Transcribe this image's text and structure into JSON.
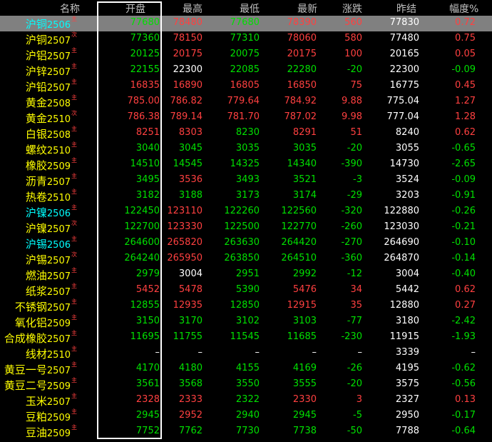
{
  "colors": {
    "up": "#ff4040",
    "down": "#00e000",
    "flat": "#ffffff",
    "name": "#ffff00",
    "name_alt": "#00ffff"
  },
  "headers": [
    "名称",
    "开盘",
    "最高",
    "最低",
    "最新",
    "涨跌",
    "昨结",
    "幅度%"
  ],
  "rows": [
    {
      "name": "沪铜",
      "code": "2506",
      "tag": "主",
      "nc": "cyan",
      "sel": true,
      "cells": [
        [
          "77680",
          "d"
        ],
        [
          "78480",
          "u"
        ],
        [
          "77680",
          "d"
        ],
        [
          "78390",
          "u"
        ],
        [
          "560",
          "u"
        ],
        [
          "77830",
          "w"
        ],
        [
          "0.72",
          "u"
        ]
      ]
    },
    {
      "name": "沪铜",
      "code": "2507",
      "tag": "次",
      "nc": "yellow",
      "cells": [
        [
          "77360",
          "d"
        ],
        [
          "78150",
          "u"
        ],
        [
          "77310",
          "d"
        ],
        [
          "78060",
          "u"
        ],
        [
          "580",
          "u"
        ],
        [
          "77480",
          "w"
        ],
        [
          "0.75",
          "u"
        ]
      ]
    },
    {
      "name": "沪铝",
      "code": "2507",
      "tag": "主",
      "nc": "yellow",
      "cells": [
        [
          "20125",
          "d"
        ],
        [
          "20175",
          "u"
        ],
        [
          "20075",
          "d"
        ],
        [
          "20175",
          "u"
        ],
        [
          "100",
          "u"
        ],
        [
          "20165",
          "w"
        ],
        [
          "0.05",
          "u"
        ]
      ]
    },
    {
      "name": "沪锌",
      "code": "2507",
      "tag": "主",
      "nc": "yellow",
      "cells": [
        [
          "22155",
          "d"
        ],
        [
          "22300",
          "w"
        ],
        [
          "22085",
          "d"
        ],
        [
          "22280",
          "d"
        ],
        [
          "-20",
          "d"
        ],
        [
          "22300",
          "w"
        ],
        [
          "-0.09",
          "d"
        ]
      ]
    },
    {
      "name": "沪铅",
      "code": "2507",
      "tag": "主",
      "nc": "yellow",
      "cells": [
        [
          "16835",
          "u"
        ],
        [
          "16890",
          "u"
        ],
        [
          "16805",
          "u"
        ],
        [
          "16850",
          "u"
        ],
        [
          "75",
          "u"
        ],
        [
          "16775",
          "w"
        ],
        [
          "0.45",
          "u"
        ]
      ]
    },
    {
      "name": "黄金",
      "code": "2508",
      "tag": "主",
      "nc": "yellow",
      "cells": [
        [
          "785.00",
          "u"
        ],
        [
          "786.82",
          "u"
        ],
        [
          "779.64",
          "u"
        ],
        [
          "784.92",
          "u"
        ],
        [
          "9.88",
          "u"
        ],
        [
          "775.04",
          "w"
        ],
        [
          "1.27",
          "u"
        ]
      ]
    },
    {
      "name": "黄金",
      "code": "2510",
      "tag": "次",
      "nc": "yellow",
      "cells": [
        [
          "786.38",
          "u"
        ],
        [
          "789.14",
          "u"
        ],
        [
          "781.70",
          "u"
        ],
        [
          "787.02",
          "u"
        ],
        [
          "9.98",
          "u"
        ],
        [
          "777.04",
          "w"
        ],
        [
          "1.28",
          "u"
        ]
      ]
    },
    {
      "name": "白银",
      "code": "2508",
      "tag": "主",
      "nc": "yellow",
      "cells": [
        [
          "8251",
          "u"
        ],
        [
          "8303",
          "u"
        ],
        [
          "8230",
          "d"
        ],
        [
          "8291",
          "u"
        ],
        [
          "51",
          "u"
        ],
        [
          "8240",
          "w"
        ],
        [
          "0.62",
          "u"
        ]
      ]
    },
    {
      "name": "螺纹",
      "code": "2510",
      "tag": "主",
      "nc": "yellow",
      "cells": [
        [
          "3040",
          "d"
        ],
        [
          "3045",
          "d"
        ],
        [
          "3035",
          "d"
        ],
        [
          "3035",
          "d"
        ],
        [
          "-20",
          "d"
        ],
        [
          "3055",
          "w"
        ],
        [
          "-0.65",
          "d"
        ]
      ]
    },
    {
      "name": "橡胶",
      "code": "2509",
      "tag": "主",
      "nc": "yellow",
      "cells": [
        [
          "14510",
          "d"
        ],
        [
          "14545",
          "d"
        ],
        [
          "14325",
          "d"
        ],
        [
          "14340",
          "d"
        ],
        [
          "-390",
          "d"
        ],
        [
          "14730",
          "w"
        ],
        [
          "-2.65",
          "d"
        ]
      ]
    },
    {
      "name": "沥青",
      "code": "2507",
      "tag": "主",
      "nc": "yellow",
      "cells": [
        [
          "3495",
          "d"
        ],
        [
          "3536",
          "u"
        ],
        [
          "3493",
          "d"
        ],
        [
          "3521",
          "d"
        ],
        [
          "-3",
          "d"
        ],
        [
          "3524",
          "w"
        ],
        [
          "-0.09",
          "d"
        ]
      ]
    },
    {
      "name": "热卷",
      "code": "2510",
      "tag": "主",
      "nc": "yellow",
      "cells": [
        [
          "3182",
          "d"
        ],
        [
          "3188",
          "d"
        ],
        [
          "3173",
          "d"
        ],
        [
          "3174",
          "d"
        ],
        [
          "-29",
          "d"
        ],
        [
          "3203",
          "w"
        ],
        [
          "-0.91",
          "d"
        ]
      ]
    },
    {
      "name": "沪镍",
      "code": "2506",
      "tag": "主",
      "nc": "cyan",
      "cells": [
        [
          "122450",
          "d"
        ],
        [
          "123110",
          "u"
        ],
        [
          "122260",
          "d"
        ],
        [
          "122560",
          "d"
        ],
        [
          "-320",
          "d"
        ],
        [
          "122880",
          "w"
        ],
        [
          "-0.26",
          "d"
        ]
      ]
    },
    {
      "name": "沪镍",
      "code": "2507",
      "tag": "次",
      "nc": "yellow",
      "cells": [
        [
          "122700",
          "d"
        ],
        [
          "123330",
          "u"
        ],
        [
          "122500",
          "d"
        ],
        [
          "122770",
          "d"
        ],
        [
          "-260",
          "d"
        ],
        [
          "123030",
          "w"
        ],
        [
          "-0.21",
          "d"
        ]
      ]
    },
    {
      "name": "沪锡",
      "code": "2506",
      "tag": "主",
      "nc": "cyan",
      "cells": [
        [
          "264600",
          "d"
        ],
        [
          "265820",
          "u"
        ],
        [
          "263630",
          "d"
        ],
        [
          "264420",
          "d"
        ],
        [
          "-270",
          "d"
        ],
        [
          "264690",
          "w"
        ],
        [
          "-0.10",
          "d"
        ]
      ]
    },
    {
      "name": "沪锡",
      "code": "2507",
      "tag": "次",
      "nc": "yellow",
      "cells": [
        [
          "264240",
          "d"
        ],
        [
          "265950",
          "u"
        ],
        [
          "263850",
          "d"
        ],
        [
          "264510",
          "d"
        ],
        [
          "-360",
          "d"
        ],
        [
          "264870",
          "w"
        ],
        [
          "-0.14",
          "d"
        ]
      ]
    },
    {
      "name": "燃油",
      "code": "2507",
      "tag": "主",
      "nc": "yellow",
      "cells": [
        [
          "2979",
          "d"
        ],
        [
          "3004",
          "w"
        ],
        [
          "2951",
          "d"
        ],
        [
          "2992",
          "d"
        ],
        [
          "-12",
          "d"
        ],
        [
          "3004",
          "w"
        ],
        [
          "-0.40",
          "d"
        ]
      ]
    },
    {
      "name": "纸浆",
      "code": "2507",
      "tag": "主",
      "nc": "yellow",
      "cells": [
        [
          "5452",
          "u"
        ],
        [
          "5478",
          "u"
        ],
        [
          "5390",
          "d"
        ],
        [
          "5476",
          "u"
        ],
        [
          "34",
          "u"
        ],
        [
          "5442",
          "w"
        ],
        [
          "0.62",
          "u"
        ]
      ]
    },
    {
      "name": "不锈钢",
      "code": "2507",
      "tag": "主",
      "nc": "yellow",
      "cells": [
        [
          "12855",
          "d"
        ],
        [
          "12935",
          "u"
        ],
        [
          "12850",
          "d"
        ],
        [
          "12915",
          "u"
        ],
        [
          "35",
          "u"
        ],
        [
          "12880",
          "w"
        ],
        [
          "0.27",
          "u"
        ]
      ]
    },
    {
      "name": "氧化铝",
      "code": "2509",
      "tag": "主",
      "nc": "yellow",
      "cells": [
        [
          "3150",
          "d"
        ],
        [
          "3170",
          "d"
        ],
        [
          "3102",
          "d"
        ],
        [
          "3103",
          "d"
        ],
        [
          "-77",
          "d"
        ],
        [
          "3180",
          "w"
        ],
        [
          "-2.42",
          "d"
        ]
      ]
    },
    {
      "name": "合成橡胶",
      "code": "2507",
      "tag": "主",
      "nc": "yellow",
      "cells": [
        [
          "11695",
          "d"
        ],
        [
          "11755",
          "d"
        ],
        [
          "11545",
          "d"
        ],
        [
          "11685",
          "d"
        ],
        [
          "-230",
          "d"
        ],
        [
          "11915",
          "w"
        ],
        [
          "-1.93",
          "d"
        ]
      ]
    },
    {
      "name": "线材",
      "code": "2510",
      "tag": "主",
      "nc": "yellow",
      "cells": [
        [
          "–",
          "w"
        ],
        [
          "–",
          "w"
        ],
        [
          "–",
          "w"
        ],
        [
          "–",
          "w"
        ],
        [
          "–",
          "w"
        ],
        [
          "3339",
          "w"
        ],
        [
          "–",
          "w"
        ]
      ]
    },
    {
      "name": "黄豆一号",
      "code": "2507",
      "tag": "主",
      "nc": "yellow",
      "cells": [
        [
          "4170",
          "d"
        ],
        [
          "4180",
          "d"
        ],
        [
          "4155",
          "d"
        ],
        [
          "4169",
          "d"
        ],
        [
          "-26",
          "d"
        ],
        [
          "4195",
          "w"
        ],
        [
          "-0.62",
          "d"
        ]
      ]
    },
    {
      "name": "黄豆二号",
      "code": "2509",
      "tag": "主",
      "nc": "yellow",
      "cells": [
        [
          "3561",
          "d"
        ],
        [
          "3568",
          "d"
        ],
        [
          "3550",
          "d"
        ],
        [
          "3555",
          "d"
        ],
        [
          "-20",
          "d"
        ],
        [
          "3575",
          "w"
        ],
        [
          "-0.56",
          "d"
        ]
      ]
    },
    {
      "name": "玉米",
      "code": "2507",
      "tag": "主",
      "nc": "yellow",
      "cells": [
        [
          "2328",
          "u"
        ],
        [
          "2333",
          "u"
        ],
        [
          "2322",
          "d"
        ],
        [
          "2330",
          "u"
        ],
        [
          "3",
          "u"
        ],
        [
          "2327",
          "w"
        ],
        [
          "0.13",
          "u"
        ]
      ]
    },
    {
      "name": "豆粕",
      "code": "2509",
      "tag": "主",
      "nc": "yellow",
      "cells": [
        [
          "2945",
          "d"
        ],
        [
          "2952",
          "u"
        ],
        [
          "2940",
          "d"
        ],
        [
          "2945",
          "d"
        ],
        [
          "-5",
          "d"
        ],
        [
          "2950",
          "w"
        ],
        [
          "-0.17",
          "d"
        ]
      ]
    },
    {
      "name": "豆油",
      "code": "2509",
      "tag": "主",
      "nc": "yellow",
      "cells": [
        [
          "7752",
          "d"
        ],
        [
          "7762",
          "d"
        ],
        [
          "7730",
          "d"
        ],
        [
          "7738",
          "d"
        ],
        [
          "-50",
          "d"
        ],
        [
          "7788",
          "w"
        ],
        [
          "-0.64",
          "d"
        ]
      ]
    }
  ]
}
